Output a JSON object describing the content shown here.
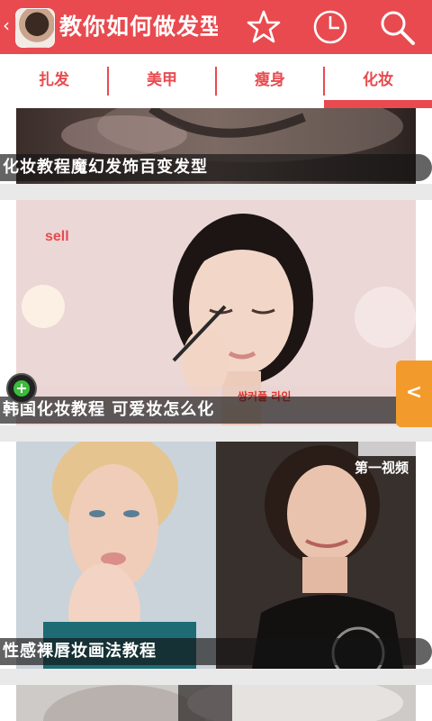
{
  "header": {
    "back_chevron": "‹",
    "app_icon": "hairstyle-avatar-icon",
    "title": "教你如何做发型",
    "star_icon": "star-icon",
    "history_icon": "clock-icon",
    "search_icon": "search-icon",
    "bg_color": "#e84a4f"
  },
  "tabs": [
    {
      "label": "扎发",
      "active": false
    },
    {
      "label": "美甲",
      "active": false
    },
    {
      "label": "瘦身",
      "active": false
    },
    {
      "label": "化妆",
      "active": true
    }
  ],
  "cards": [
    {
      "caption": "化妆教程魔幻发饰百变发型"
    },
    {
      "caption": "韩国化妆教程 可爱妆怎么化",
      "video_brand": "sell",
      "video_subtitle": "쌍커플 라인"
    },
    {
      "caption": "性感裸唇妆画法教程",
      "video_brand": "第一视频"
    },
    {
      "caption": ""
    }
  ],
  "side_handle": {
    "label": "<",
    "color": "#f29b2c"
  },
  "fab": {
    "label": "+",
    "color": "#3dbb3d"
  }
}
